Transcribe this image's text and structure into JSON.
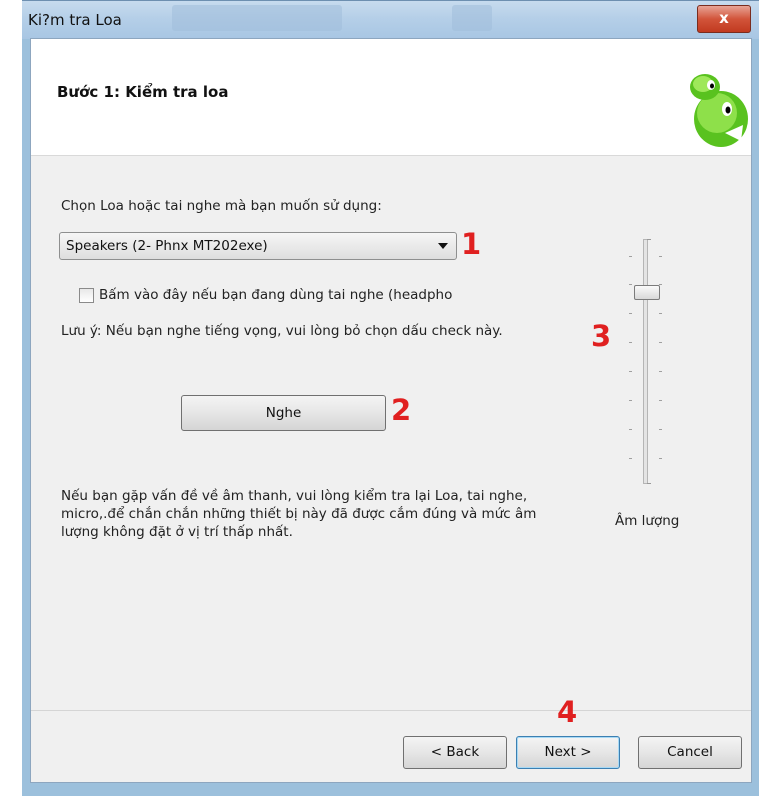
{
  "window": {
    "title": "Ki?m tra Loa",
    "close_label": "x"
  },
  "header": {
    "step_title": "Bước 1: Kiểm tra loa"
  },
  "speaker": {
    "prompt": "Chọn Loa hoặc tai nghe mà bạn muốn sử dụng:",
    "selected": "Speakers (2- Phnx MT202exe)"
  },
  "headphone": {
    "checkbox_label": "Bấm vào đây nếu bạn đang dùng tai nghe (headpho",
    "checked": false,
    "note": "Lưu ý: Nếu bạn nghe tiếng vọng, vui lòng bỏ chọn dấu check này."
  },
  "listen_button": "Nghe",
  "help_text": "Nếu bạn gặp vấn đề về âm thanh, vui lòng kiểm tra lại Loa, tai nghe, micro,.để chắn chắn những thiết bị này đã được cắm đúng và mức âm lượng không đặt ở vị trí thấp nhất.",
  "volume": {
    "label": "Âm lượng",
    "level": 0.78
  },
  "annotations": {
    "n1": "1",
    "n2": "2",
    "n3": "3",
    "n4": "4",
    "color": "#e02020"
  },
  "footer": {
    "back": "< Back",
    "next": "Next >",
    "cancel": "Cancel"
  },
  "colors": {
    "titlebar": "#b5cfe8",
    "close_button": "#d2543a",
    "dialog_bg": "#f0f0f0",
    "header_bg": "#ffffff",
    "mascot_green": "#59c21f"
  }
}
